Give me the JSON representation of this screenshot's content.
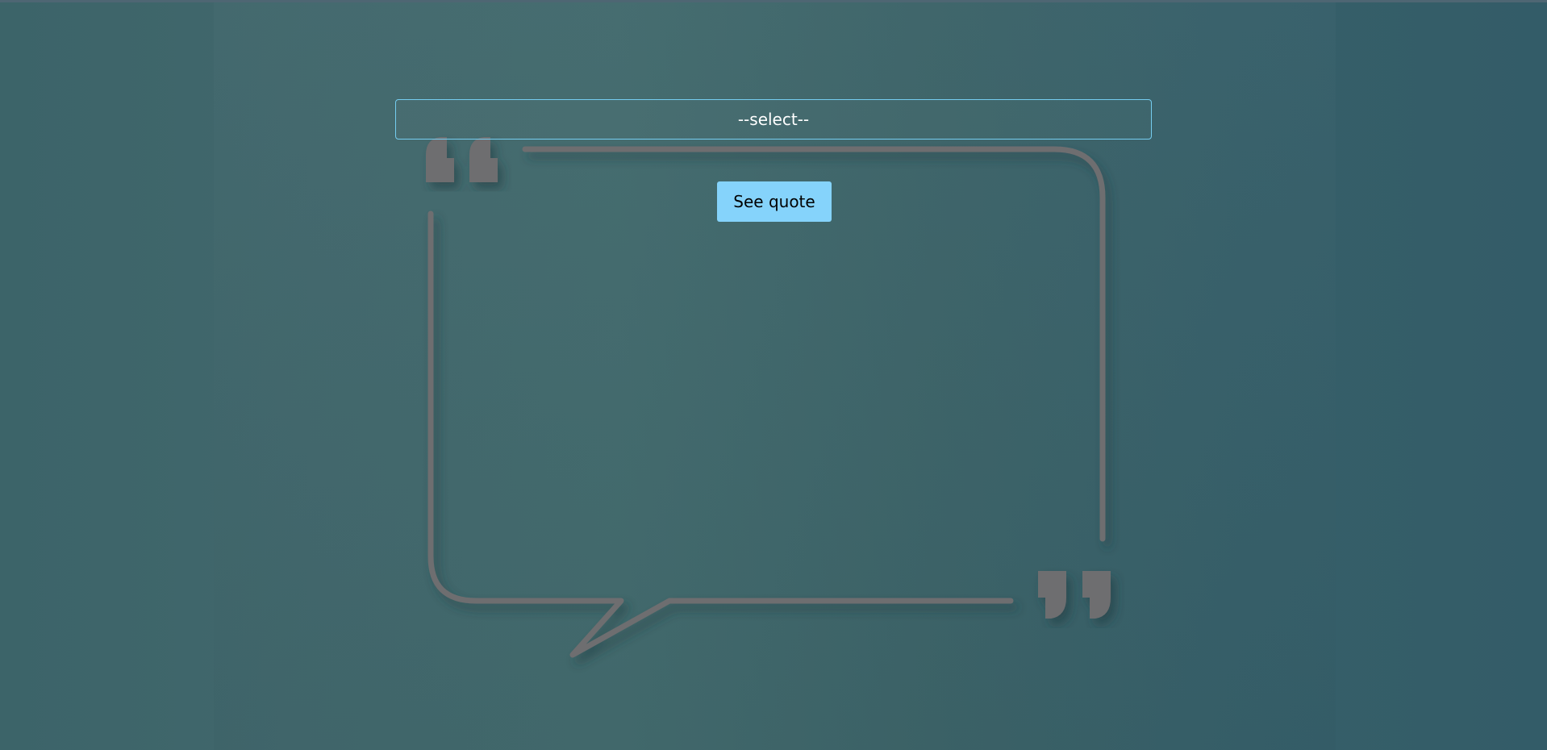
{
  "quote_form": {
    "select_value": "--select--",
    "submit_label": "See quote"
  },
  "colors": {
    "background": "#3f6369",
    "select_border": "#75cdf0",
    "button_background": "#85d3fb",
    "bubble_outline": "#6e6e70"
  },
  "icons": {
    "open_quote": "open-quote-marks-icon",
    "close_quote": "close-quote-marks-icon"
  }
}
